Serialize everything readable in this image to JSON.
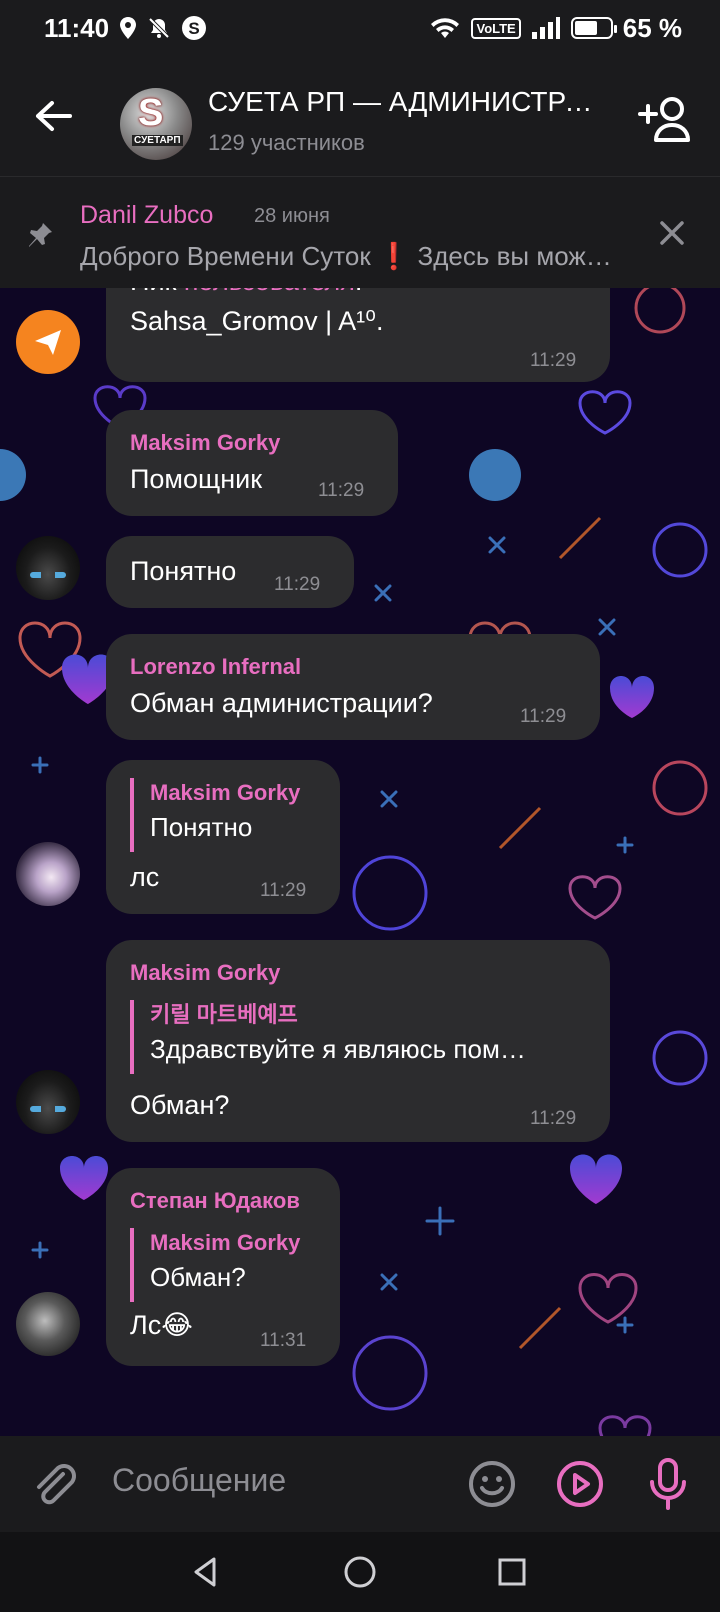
{
  "status_bar": {
    "time": "11:40",
    "battery": "65 %",
    "battery_level": 0.65,
    "network_badge": "VoLTE",
    "icons": [
      "location-icon",
      "mute-bell-icon",
      "s-app-icon",
      "wifi-icon",
      "volte-icon",
      "signal-icon",
      "battery-icon"
    ]
  },
  "header": {
    "title": "СУЕТА РП — АДМИНИСТРАЦИЯ",
    "subtitle": "129 участников",
    "avatar_letter": "S",
    "avatar_caption": "СУЕТАРП"
  },
  "pinned": {
    "author": "Danil Zubco",
    "date": "28 июня",
    "text": "Доброго Времени Суток ❗ Здесь вы можете"
  },
  "messages": [
    {
      "id": "m1",
      "line1_prefix": "Ник ",
      "line1_highlight": "пользователя",
      "line1_suffix": ":",
      "text": "Sahsa_Gromov | A¹⁰.",
      "time": "11:29"
    },
    {
      "id": "m2",
      "sender": "Maksim Gorky",
      "text": "Помощник",
      "time": "11:29"
    },
    {
      "id": "m3",
      "text": "Понятно",
      "time": "11:29"
    },
    {
      "id": "m4",
      "sender": "Lorenzo Infernal",
      "text": "Обман администрации?",
      "time": "11:29"
    },
    {
      "id": "m5",
      "reply_name": "Maksim Gorky",
      "reply_text": "Понятно",
      "text": "лс",
      "time": "11:29"
    },
    {
      "id": "m6",
      "sender": "Maksim Gorky",
      "reply_name": "키릴 마트베예프",
      "reply_text": "Здравствуйте я являюсь пом…",
      "text": "Обман?",
      "time": "11:29"
    },
    {
      "id": "m7",
      "sender": "Степан Юдаков",
      "reply_name": "Maksim Gorky",
      "reply_text": "Обман?",
      "text": "Лс😂",
      "time": "11:31"
    }
  ],
  "input": {
    "placeholder": "Сообщение"
  },
  "colors": {
    "accent": "#e86ec0",
    "bubble": "#2c2c2e",
    "bar": "#1b1b1d",
    "chat_bg": "#0e0624"
  }
}
